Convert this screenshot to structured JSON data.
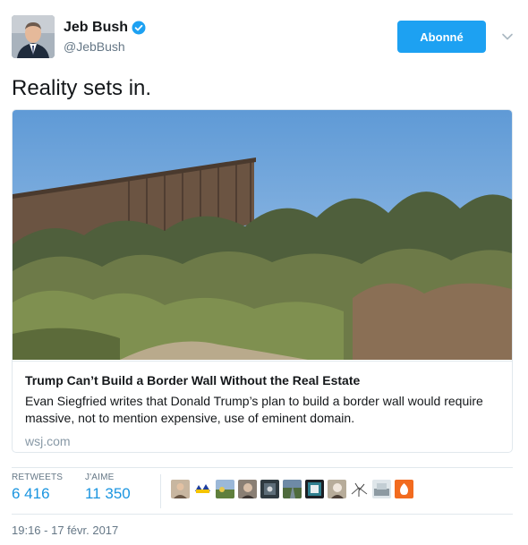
{
  "author": {
    "display_name": "Jeb Bush",
    "handle": "@JebBush",
    "verified": true
  },
  "follow_button": {
    "label": "Abonné"
  },
  "tweet": {
    "text": "Reality sets in."
  },
  "card": {
    "title": "Trump Can’t Build a Border Wall Without the Real Estate",
    "description": "Evan Siegfried writes that Donald Trump’s plan to build a border wall would require massive, not to mention expensive, use of eminent domain.",
    "domain": "wsj.com"
  },
  "stats": {
    "retweets_label": "RETWEETS",
    "retweets_value": "6 416",
    "likes_label": "J'AIME",
    "likes_value": "11 350"
  },
  "timestamp": "19:16 - 17 févr. 2017",
  "colors": {
    "accent": "#1da1f2",
    "link": "#1b95e0",
    "muted": "#657786",
    "border": "#e1e8ed"
  },
  "icons": [
    "verified-badge-icon",
    "chevron-down-icon"
  ]
}
